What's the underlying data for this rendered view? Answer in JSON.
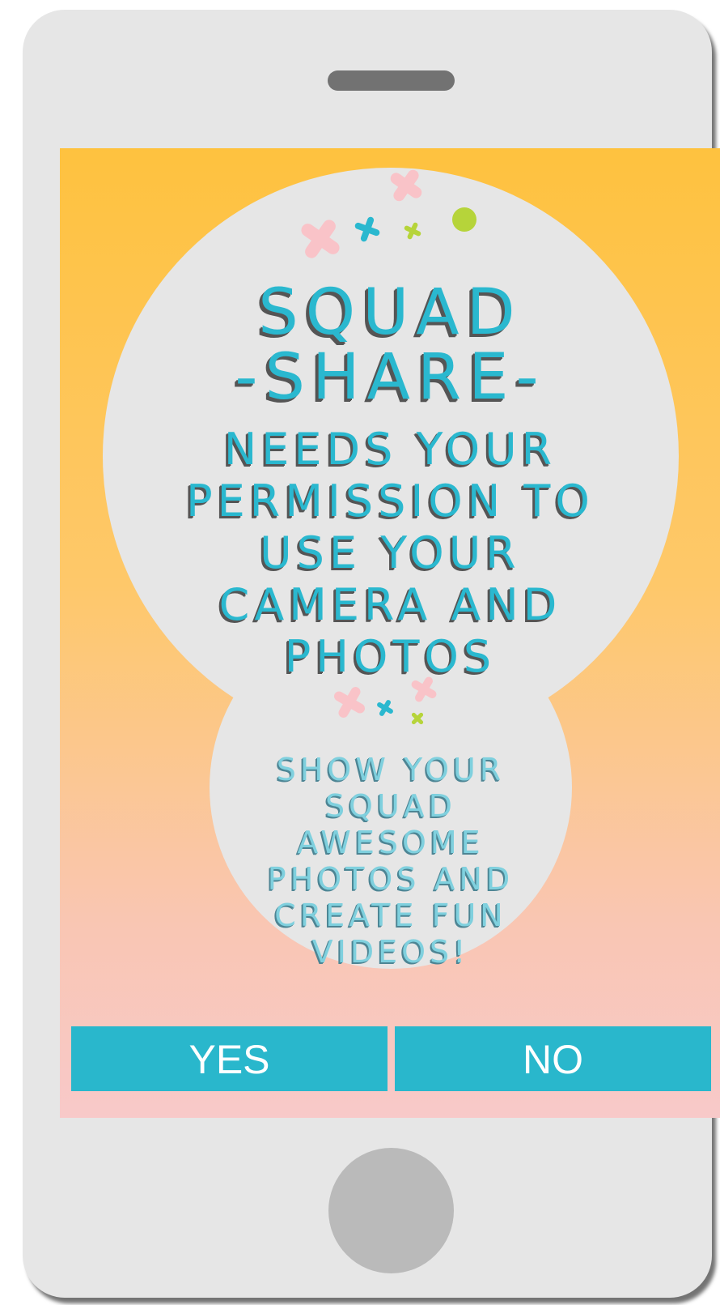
{
  "app": {
    "title_line1": "SQUAD",
    "title_line2": "-SHARE-"
  },
  "permission": {
    "message": "NEEDS YOUR PERMISSION TO USE YOUR CAMERA AND PHOTOS"
  },
  "promo": {
    "message": "SHOW YOUR SQUAD AWESOME PHOTOS AND CREATE FUN VIDEOS!"
  },
  "buttons": {
    "yes_label": "YES",
    "no_label": "NO"
  },
  "icons": {
    "confetti": [
      "pink-cross-icon",
      "blue-cross-icon",
      "green-cross-icon",
      "green-dot-icon"
    ]
  },
  "colors": {
    "accent": "#29b7cc",
    "screen_top": "#fec23f",
    "screen_bottom": "#f8c9c9",
    "bubble": "#e6e6e6",
    "frame": "#e6e6e6",
    "confetti_pink": "#f9c3c8",
    "confetti_blue": "#2ab8cf",
    "confetti_green": "#b6d43a"
  }
}
